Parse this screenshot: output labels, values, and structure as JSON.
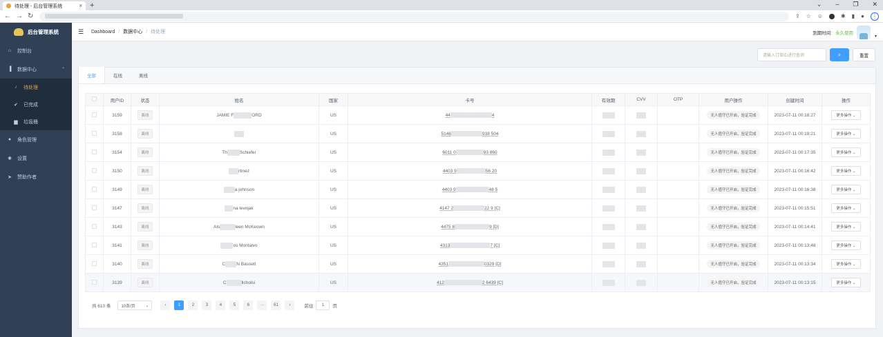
{
  "browser": {
    "tab_title": "待处理 - 后台管理系统",
    "new_tab": "+",
    "close": "×"
  },
  "sidebar": {
    "logo_text": "后台管理系统",
    "items": [
      {
        "label": "控制台",
        "icon": "dashboard-icon"
      },
      {
        "label": "数据中心",
        "icon": "chart-icon"
      },
      {
        "label": "角色管理",
        "icon": "user-icon"
      },
      {
        "label": "设置",
        "icon": "gear-icon"
      },
      {
        "label": "赞助作者",
        "icon": "send-icon"
      }
    ],
    "sub_items": [
      {
        "label": "待处理",
        "icon": "bell-icon"
      },
      {
        "label": "已完成",
        "icon": "check-icon"
      },
      {
        "label": "垃圾桶",
        "icon": "trash-icon"
      }
    ]
  },
  "header": {
    "breadcrumb": [
      "Dashboard",
      "数据中心",
      "待处理"
    ],
    "expiry_label": "到期时间:",
    "expiry_value": "永久使用"
  },
  "search": {
    "placeholder": "请输入订单ID进行查询",
    "reset_label": "重置"
  },
  "tabs": [
    "全部",
    "在线",
    "离线"
  ],
  "table": {
    "headers": [
      "",
      "用户ID",
      "状态",
      "姓名",
      "国家",
      "卡号",
      "有效期",
      "CVV",
      "OTP",
      "用户操作",
      "创建时间",
      "操作"
    ],
    "rows": [
      {
        "id": "3159",
        "status": "离线",
        "name_a": "JAMIE F",
        "name_b": "ORD",
        "country": "US",
        "card_a": "44",
        "card_b": "4",
        "action": "无人值守已开启，验证完成",
        "created": "2023-07-11 00:18:27",
        "more": "更多操作"
      },
      {
        "id": "3158",
        "status": "离线",
        "name_a": "",
        "name_b": "",
        "country": "US",
        "card_a": "5146",
        "card_b": "938 504",
        "action": "无人值守已开启，验证完成",
        "created": "2023-07-11 00:18:21",
        "more": "更多操作"
      },
      {
        "id": "3154",
        "status": "离线",
        "name_a": "Th",
        "name_b": "Schiefer",
        "country": "US",
        "card_a": "6011 0",
        "card_b": "93 860",
        "action": "无人值守已开启，验证完成",
        "created": "2023-07-11 00:17:35",
        "more": "更多操作"
      },
      {
        "id": "3150",
        "status": "离线",
        "name_a": "",
        "name_b": "rtinez",
        "country": "US",
        "card_a": "4403 9",
        "card_b": "56 20",
        "action": "无人值守已开启，验证完成",
        "created": "2023-07-11 00:16:42",
        "more": "更多操作"
      },
      {
        "id": "3149",
        "status": "离线",
        "name_a": "",
        "name_b": "a johnson",
        "country": "US",
        "card_a": "4403 9",
        "card_b": "48 5",
        "action": "无人值守已开启，验证完成",
        "created": "2023-07-11 00:16:38",
        "more": "更多操作"
      },
      {
        "id": "3147",
        "status": "离线",
        "name_a": "",
        "name_b": "na levnjak",
        "country": "US",
        "card_a": "4147 2",
        "card_b": "22 9 [C]",
        "action": "无人值守已开启，验证完成",
        "created": "2023-07-11 00:15:51",
        "more": "更多操作"
      },
      {
        "id": "3143",
        "status": "离线",
        "name_a": "Als",
        "name_b": "leen McKeown",
        "country": "US",
        "card_a": "4475 8",
        "card_b": "9 [D]",
        "action": "无人值守已开启，验证完成",
        "created": "2023-07-11 00:14:41",
        "more": "更多操作"
      },
      {
        "id": "3141",
        "status": "离线",
        "name_a": "",
        "name_b": "os Montalvo",
        "country": "US",
        "card_a": "4313",
        "card_b": "7 [C]",
        "action": "无人值守已开启，验证完成",
        "created": "2023-07-11 00:13:48",
        "more": "更多操作"
      },
      {
        "id": "3140",
        "status": "离线",
        "name_a": "C",
        "name_b": "N Bassett",
        "country": "US",
        "card_a": "4351",
        "card_b": "0329 [D]",
        "action": "无人值守已开启，验证完成",
        "created": "2023-07-11 00:13:34",
        "more": "更多操作"
      },
      {
        "id": "3139",
        "status": "离线",
        "name_a": "C",
        "name_b": "llcholsi",
        "country": "US",
        "card_a": "412",
        "card_b": "2 6439 [C]",
        "action": "无人值守已开启，验证完成",
        "created": "2023-07-11 00:13:15",
        "more": "更多操作"
      }
    ]
  },
  "pagination": {
    "total": "共 610 条",
    "page_size": "10条/页",
    "pages": [
      "1",
      "2",
      "3",
      "4",
      "5",
      "6",
      "···",
      "61"
    ],
    "goto_label": "前往",
    "goto_value": "1",
    "page_unit": "页"
  },
  "colors": {
    "sidebar_bg": "#304156",
    "active": "#e6a23c",
    "primary": "#409eff",
    "success": "#67c23a"
  }
}
